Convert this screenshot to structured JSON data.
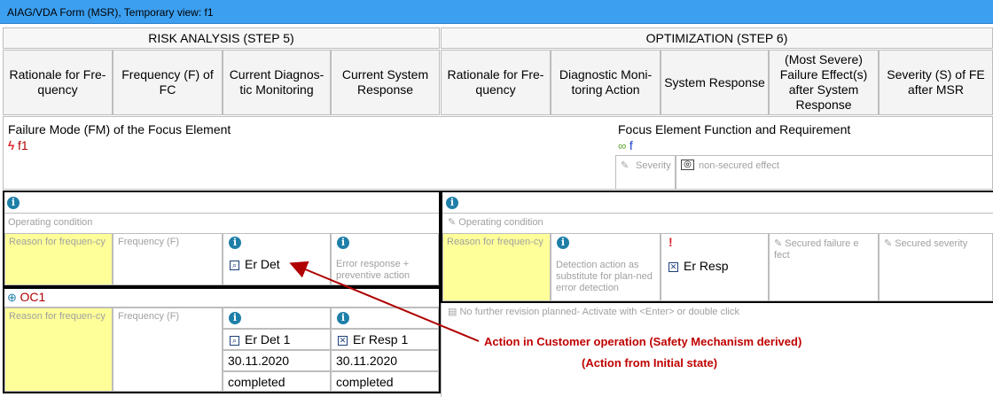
{
  "window": {
    "title": "AIAG/VDA Form (MSR), Temporary view: f1"
  },
  "steps": {
    "risk": "RISK ANALYSIS (STEP 5)",
    "optimization": "OPTIMIZATION  (STEP 6)"
  },
  "columns": {
    "c1": "Rationale for Fre-quency",
    "c2": "Frequency (F) of FC",
    "c3": "Current Diagnos-tic Monitoring",
    "c4": "Current System Response",
    "c5": "Rationale for Fre-quency",
    "c6": "Diagnostic Moni-toring Action",
    "c7": "System Response",
    "c8": "(Most Severe) Failure Effect(s) after System Response",
    "c9": "Severity (S) of FE after MSR"
  },
  "failure_mode": {
    "label": "Failure Mode (FM) of the Focus Element",
    "value": "f1"
  },
  "focus_element": {
    "label": "Focus Element Function and Requirement",
    "value": "f",
    "severity": "Severity",
    "non_secured": "non-secured effect"
  },
  "operating_condition_label": "Operating condition",
  "reason_placeholder": "Reason for frequen-cy",
  "frequency_placeholder": "Frequency (F)",
  "row1": {
    "diag": "Er Det",
    "response_placeholder": "Error response + preventive action"
  },
  "oc": {
    "label": "OC1",
    "diag": "Er Det 1",
    "resp": "Er Resp 1",
    "date1": "30.11.2020",
    "date2": "30.11.2020",
    "status1": "completed",
    "status2": "completed"
  },
  "opt": {
    "detection_placeholder": "Detection action as substitute for plan-ned error detection",
    "resp": "Er Resp",
    "secured_failure": "Secured failure e fect",
    "secured_severity": "Secured severity",
    "revision": "No further revision planned- Activate with <Enter> or double click"
  },
  "annotation": {
    "line1": "Action in Customer operation (Safety Mechanism derived)",
    "line2": "(Action from Initial state)"
  },
  "icons": {
    "info": "i",
    "failure_mode": "lightning-icon",
    "function": "link-icon",
    "pencil": "pencil-icon",
    "operating": "steering-wheel-icon"
  }
}
